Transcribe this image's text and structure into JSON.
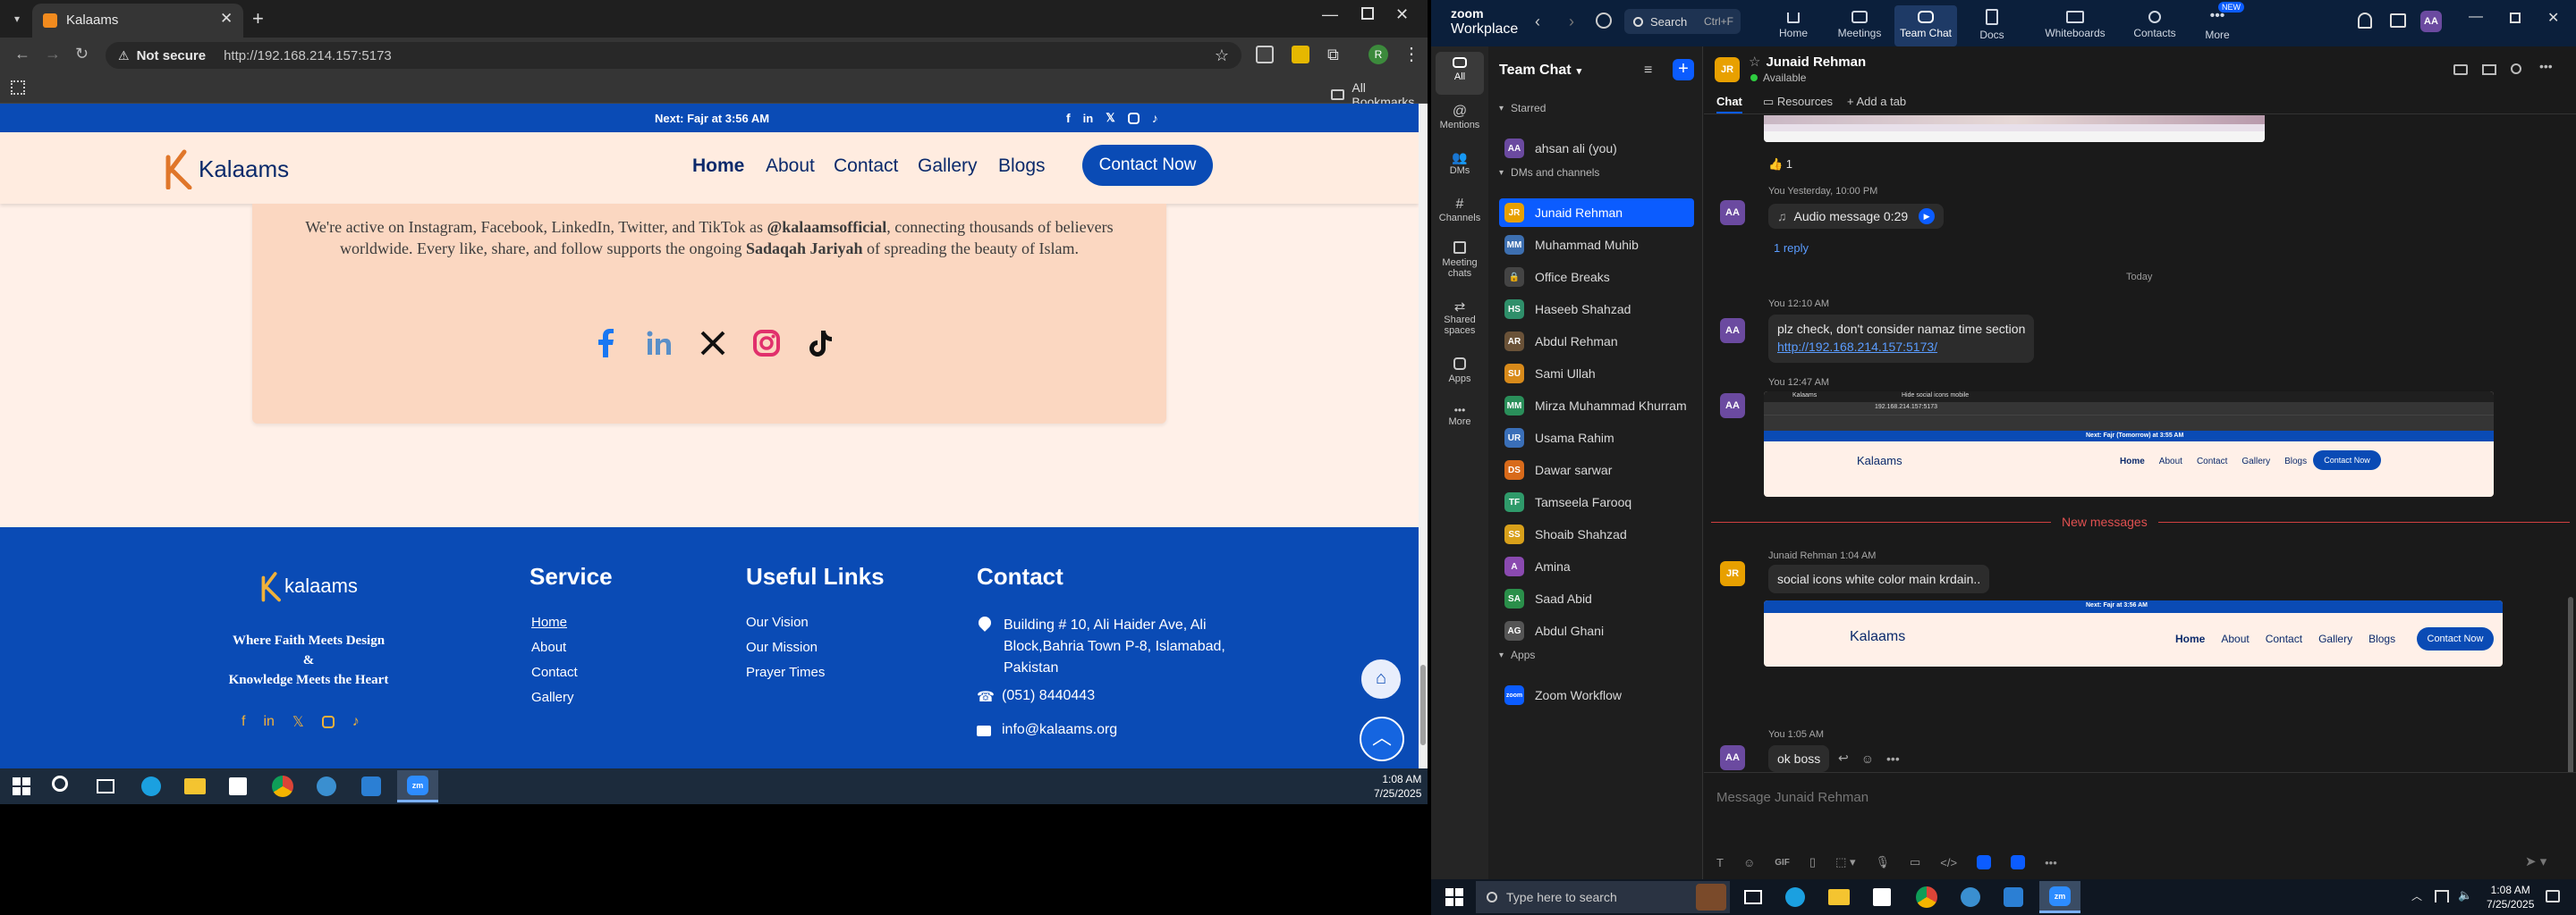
{
  "browser": {
    "tab_title": "Kalaams",
    "not_secure": "Not secure",
    "url": "http://192.168.214.157:5173",
    "all_bookmarks": "All Bookmarks"
  },
  "site": {
    "prayer_bar": "Next: Fajr at 3:56 AM",
    "logo": "Kalaams",
    "nav": [
      "Home",
      "About",
      "Contact",
      "Gallery",
      "Blogs"
    ],
    "cta": "Contact Now",
    "social_text_1": "We're active on Instagram, Facebook, LinkedIn, Twitter, and TikTok as ",
    "social_handle": "@kalaamsofficial",
    "social_text_2": ", connecting thousands of believers worldwide. Every like, share, and follow supports the ongoing ",
    "social_sadaqah": "Sadaqah Jariyah",
    "social_text_3": " of spreading the beauty of Islam.",
    "footer": {
      "logo": "kalaams",
      "tagline_1": "Where Faith Meets Design",
      "tagline_amp": "&",
      "tagline_2": "Knowledge Meets the Heart",
      "service_heading": "Service",
      "service_links": [
        "Home",
        "About",
        "Contact",
        "Gallery"
      ],
      "useful_heading": "Useful Links",
      "useful_links": [
        "Our Vision",
        "Our Mission",
        "Prayer Times"
      ],
      "contact_heading": "Contact",
      "address": "Building # 10, Ali Haider Ave, Ali Block,Bahria Town P-8, Islamabad, Pakistan",
      "phone": "(051) 8440443",
      "email": "info@kalaams.org"
    }
  },
  "taskbar_left": {
    "time": "1:08 AM",
    "date": "7/25/2025"
  },
  "zoom": {
    "brand_top": "zoom",
    "brand_bottom": "Workplace",
    "search": "Search",
    "search_shortcut": "Ctrl+F",
    "nav": [
      "Home",
      "Meetings",
      "Team Chat",
      "Docs",
      "Whiteboards",
      "Contacts",
      "More"
    ],
    "new_badge": "NEW",
    "user_initials": "AA",
    "rail": [
      "All",
      "Mentions",
      "DMs",
      "Channels",
      "Meeting chats",
      "Shared spaces",
      "Apps",
      "More"
    ],
    "list_title": "Team Chat",
    "starred_label": "Starred",
    "starred": [
      {
        "name": "ahsan ali (you)",
        "initials": "AA",
        "color": "#6b4aa0"
      }
    ],
    "dms_label": "DMs and channels",
    "contacts": [
      {
        "name": "Junaid Rehman",
        "initials": "JR",
        "color": "#e8a000"
      },
      {
        "name": "Muhammad Muhib",
        "initials": "MM",
        "color": "#3d6fb0"
      },
      {
        "name": "Office Breaks",
        "initials": "🔒",
        "color": "#444444"
      },
      {
        "name": "Haseeb Shahzad",
        "initials": "HS",
        "color": "#2f8f6a"
      },
      {
        "name": "Abdul Rehman",
        "initials": "AR",
        "color": "#6a5238"
      },
      {
        "name": "Sami Ullah",
        "initials": "SU",
        "color": "#d88a1a"
      },
      {
        "name": "Mirza Muhammad Khurram",
        "initials": "MM",
        "color": "#2a8f5a"
      },
      {
        "name": "Usama Rahim",
        "initials": "UR",
        "color": "#3a6fb8"
      },
      {
        "name": "Dawar sarwar",
        "initials": "DS",
        "color": "#d86a1a"
      },
      {
        "name": "Tamseela Farooq",
        "initials": "TF",
        "color": "#2f9a6a"
      },
      {
        "name": "Shoaib Shahzad",
        "initials": "SS",
        "color": "#d8a01a"
      },
      {
        "name": "Amina",
        "initials": "A",
        "color": "#8a4ab0"
      },
      {
        "name": "Saad Abid",
        "initials": "SA",
        "color": "#2a8f4a"
      },
      {
        "name": "Abdul Ghani",
        "initials": "AG",
        "color": "#555555"
      }
    ],
    "apps_label": "Apps",
    "apps": [
      {
        "name": "Zoom Workflow",
        "initials": "zoom",
        "color": "#0b5cff"
      }
    ],
    "chat_header": "Junaid Rehman",
    "chat_status": "Available",
    "tabs": [
      "Chat",
      "Resources",
      "Add a tab"
    ],
    "reaction": "👍 1",
    "msg1_meta": "You Yesterday, 10:00 PM",
    "msg1_audio": "Audio message 0:29",
    "msg1_reply": "1 reply",
    "today": "Today",
    "msg2_meta": "You 12:10 AM",
    "msg2_text": "plz check, don't consider namaz time section",
    "msg2_link": "http://192.168.214.157:5173/",
    "msg3_meta": "You 12:47 AM",
    "new_messages": "New messages",
    "msg4_meta": "Junaid Rehman 1:04 AM",
    "msg4_text": "social icons white color main krdain..",
    "msg5_meta": "You 1:05 AM",
    "msg5_text": "ok boss",
    "composer_placeholder": "Message Junaid Rehman",
    "thumb_logo": "Kalaams",
    "thumb_nav": [
      "Home",
      "About",
      "Contact",
      "Gallery",
      "Blogs"
    ],
    "thumb_cta": "Contact Now",
    "thumb_bar1": "Next: Fajr (Tomorrow) at 3:55 AM",
    "thumb_bar2": "Next: Fajr at 3:56 AM",
    "thumb_tab": "Kalaams",
    "thumb_tab2": "Hide social icons mobile",
    "thumb_url": "192.168.214.157:5173"
  },
  "taskbar_right": {
    "search": "Type here to search",
    "time": "1:08 AM",
    "date": "7/25/2025"
  }
}
